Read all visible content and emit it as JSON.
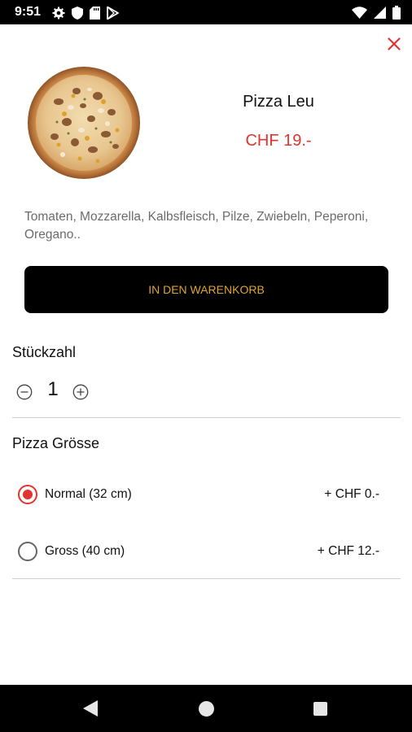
{
  "status_bar": {
    "time": "9:51",
    "left_icons": [
      "settings-gear-icon",
      "shield-icon",
      "sd-card-icon",
      "play-store-icon"
    ],
    "right_icons": [
      "wifi-icon",
      "signal-icon",
      "battery-icon"
    ]
  },
  "product": {
    "name": "Pizza Leu",
    "price": "CHF 19.-",
    "image_icon": "pizza-image",
    "ingredients": "Tomaten, Mozzarella, Kalbsfleisch, Pilze, Zwiebeln, Peperoni, Oregano.."
  },
  "cart_button": {
    "label": "IN DEN WARENKORB"
  },
  "quantity": {
    "title": "Stückzahl",
    "value": "1"
  },
  "size": {
    "title": "Pizza Grösse",
    "options": [
      {
        "label": "Normal (32 cm)",
        "price": "+ CHF 0.-",
        "selected": true
      },
      {
        "label": "Gross (40 cm)",
        "price": "+ CHF 12.-",
        "selected": false
      }
    ]
  },
  "colors": {
    "accent_red": "#e3342f",
    "button_bg": "#000000",
    "button_text": "#e0a52a"
  }
}
